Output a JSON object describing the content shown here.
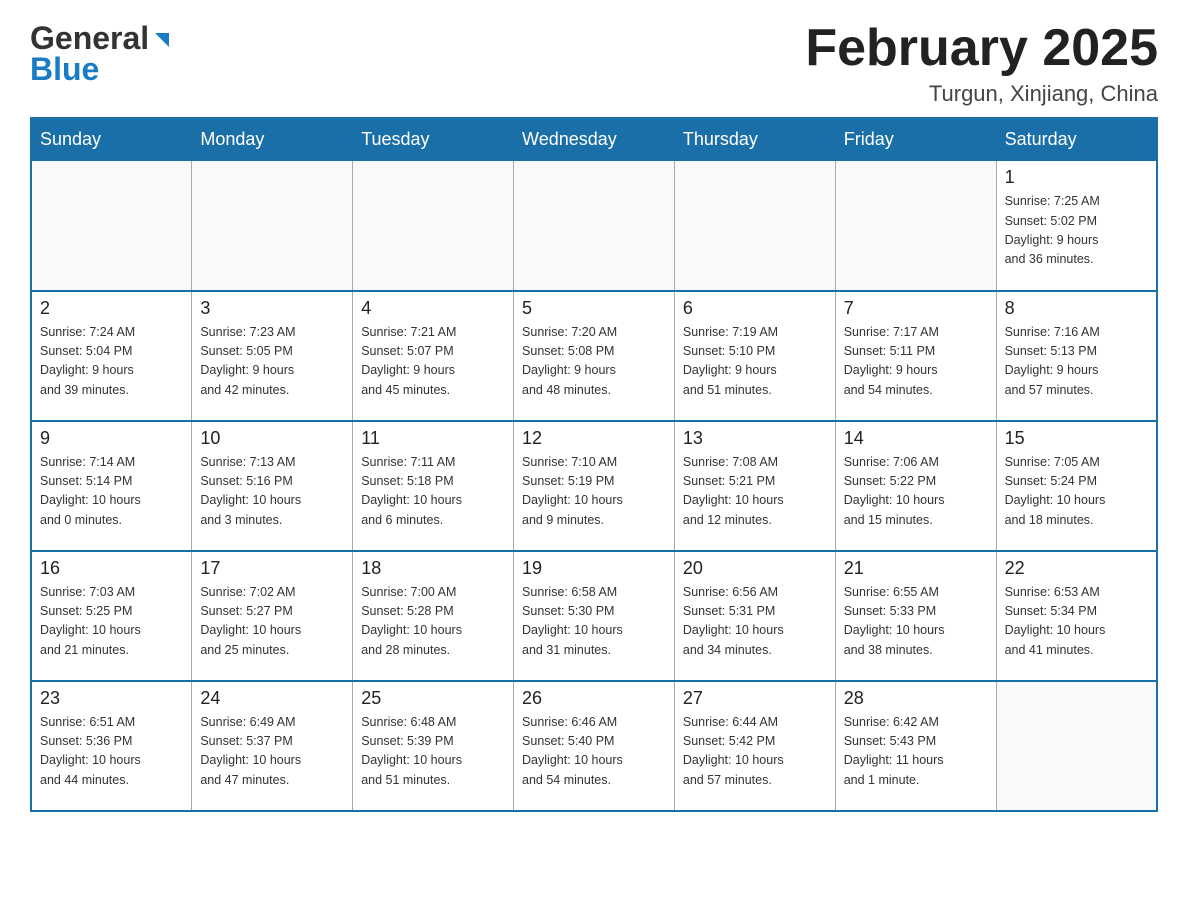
{
  "header": {
    "logo_line1": "General",
    "logo_line2": "Blue",
    "month_title": "February 2025",
    "location": "Turgun, Xinjiang, China"
  },
  "weekdays": [
    "Sunday",
    "Monday",
    "Tuesday",
    "Wednesday",
    "Thursday",
    "Friday",
    "Saturday"
  ],
  "weeks": [
    [
      {
        "day": "",
        "info": ""
      },
      {
        "day": "",
        "info": ""
      },
      {
        "day": "",
        "info": ""
      },
      {
        "day": "",
        "info": ""
      },
      {
        "day": "",
        "info": ""
      },
      {
        "day": "",
        "info": ""
      },
      {
        "day": "1",
        "info": "Sunrise: 7:25 AM\nSunset: 5:02 PM\nDaylight: 9 hours\nand 36 minutes."
      }
    ],
    [
      {
        "day": "2",
        "info": "Sunrise: 7:24 AM\nSunset: 5:04 PM\nDaylight: 9 hours\nand 39 minutes."
      },
      {
        "day": "3",
        "info": "Sunrise: 7:23 AM\nSunset: 5:05 PM\nDaylight: 9 hours\nand 42 minutes."
      },
      {
        "day": "4",
        "info": "Sunrise: 7:21 AM\nSunset: 5:07 PM\nDaylight: 9 hours\nand 45 minutes."
      },
      {
        "day": "5",
        "info": "Sunrise: 7:20 AM\nSunset: 5:08 PM\nDaylight: 9 hours\nand 48 minutes."
      },
      {
        "day": "6",
        "info": "Sunrise: 7:19 AM\nSunset: 5:10 PM\nDaylight: 9 hours\nand 51 minutes."
      },
      {
        "day": "7",
        "info": "Sunrise: 7:17 AM\nSunset: 5:11 PM\nDaylight: 9 hours\nand 54 minutes."
      },
      {
        "day": "8",
        "info": "Sunrise: 7:16 AM\nSunset: 5:13 PM\nDaylight: 9 hours\nand 57 minutes."
      }
    ],
    [
      {
        "day": "9",
        "info": "Sunrise: 7:14 AM\nSunset: 5:14 PM\nDaylight: 10 hours\nand 0 minutes."
      },
      {
        "day": "10",
        "info": "Sunrise: 7:13 AM\nSunset: 5:16 PM\nDaylight: 10 hours\nand 3 minutes."
      },
      {
        "day": "11",
        "info": "Sunrise: 7:11 AM\nSunset: 5:18 PM\nDaylight: 10 hours\nand 6 minutes."
      },
      {
        "day": "12",
        "info": "Sunrise: 7:10 AM\nSunset: 5:19 PM\nDaylight: 10 hours\nand 9 minutes."
      },
      {
        "day": "13",
        "info": "Sunrise: 7:08 AM\nSunset: 5:21 PM\nDaylight: 10 hours\nand 12 minutes."
      },
      {
        "day": "14",
        "info": "Sunrise: 7:06 AM\nSunset: 5:22 PM\nDaylight: 10 hours\nand 15 minutes."
      },
      {
        "day": "15",
        "info": "Sunrise: 7:05 AM\nSunset: 5:24 PM\nDaylight: 10 hours\nand 18 minutes."
      }
    ],
    [
      {
        "day": "16",
        "info": "Sunrise: 7:03 AM\nSunset: 5:25 PM\nDaylight: 10 hours\nand 21 minutes."
      },
      {
        "day": "17",
        "info": "Sunrise: 7:02 AM\nSunset: 5:27 PM\nDaylight: 10 hours\nand 25 minutes."
      },
      {
        "day": "18",
        "info": "Sunrise: 7:00 AM\nSunset: 5:28 PM\nDaylight: 10 hours\nand 28 minutes."
      },
      {
        "day": "19",
        "info": "Sunrise: 6:58 AM\nSunset: 5:30 PM\nDaylight: 10 hours\nand 31 minutes."
      },
      {
        "day": "20",
        "info": "Sunrise: 6:56 AM\nSunset: 5:31 PM\nDaylight: 10 hours\nand 34 minutes."
      },
      {
        "day": "21",
        "info": "Sunrise: 6:55 AM\nSunset: 5:33 PM\nDaylight: 10 hours\nand 38 minutes."
      },
      {
        "day": "22",
        "info": "Sunrise: 6:53 AM\nSunset: 5:34 PM\nDaylight: 10 hours\nand 41 minutes."
      }
    ],
    [
      {
        "day": "23",
        "info": "Sunrise: 6:51 AM\nSunset: 5:36 PM\nDaylight: 10 hours\nand 44 minutes."
      },
      {
        "day": "24",
        "info": "Sunrise: 6:49 AM\nSunset: 5:37 PM\nDaylight: 10 hours\nand 47 minutes."
      },
      {
        "day": "25",
        "info": "Sunrise: 6:48 AM\nSunset: 5:39 PM\nDaylight: 10 hours\nand 51 minutes."
      },
      {
        "day": "26",
        "info": "Sunrise: 6:46 AM\nSunset: 5:40 PM\nDaylight: 10 hours\nand 54 minutes."
      },
      {
        "day": "27",
        "info": "Sunrise: 6:44 AM\nSunset: 5:42 PM\nDaylight: 10 hours\nand 57 minutes."
      },
      {
        "day": "28",
        "info": "Sunrise: 6:42 AM\nSunset: 5:43 PM\nDaylight: 11 hours\nand 1 minute."
      },
      {
        "day": "",
        "info": ""
      }
    ]
  ]
}
